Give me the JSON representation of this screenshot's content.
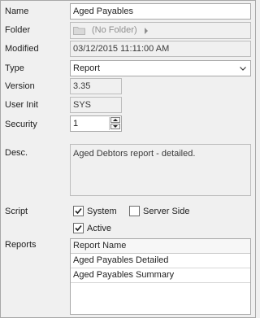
{
  "labels": {
    "name": "Name",
    "folder": "Folder",
    "modified": "Modified",
    "type": "Type",
    "version": "Version",
    "user_init": "User Init",
    "security": "Security",
    "desc": "Desc.",
    "script": "Script",
    "reports": "Reports"
  },
  "fields": {
    "name": "Aged Payables",
    "folder": "(No Folder)",
    "modified": "03/12/2015 11:11:00 AM",
    "type": "Report",
    "version": "3.35",
    "user_init": "SYS",
    "security": "1",
    "desc": "Aged Debtors report - detailed."
  },
  "script_options": {
    "system": {
      "label": "System",
      "checked": true
    },
    "server_side": {
      "label": "Server Side",
      "checked": false
    },
    "active": {
      "label": "Active",
      "checked": true
    }
  },
  "reports_grid": {
    "column": "Report Name",
    "rows": [
      "Aged Payables Detailed",
      "Aged Payables Summary"
    ]
  },
  "icons": {
    "folder": "folder-icon",
    "dropdown": "chevron-down-icon",
    "spinner_up": "spin-up-icon",
    "spinner_down": "spin-down-icon",
    "check": "checkmark-icon"
  },
  "colors": {
    "background": "#f0f0f0",
    "border": "#a8a8a8",
    "field_bg": "#ffffff",
    "disabled_text": "#8f8f8f"
  }
}
